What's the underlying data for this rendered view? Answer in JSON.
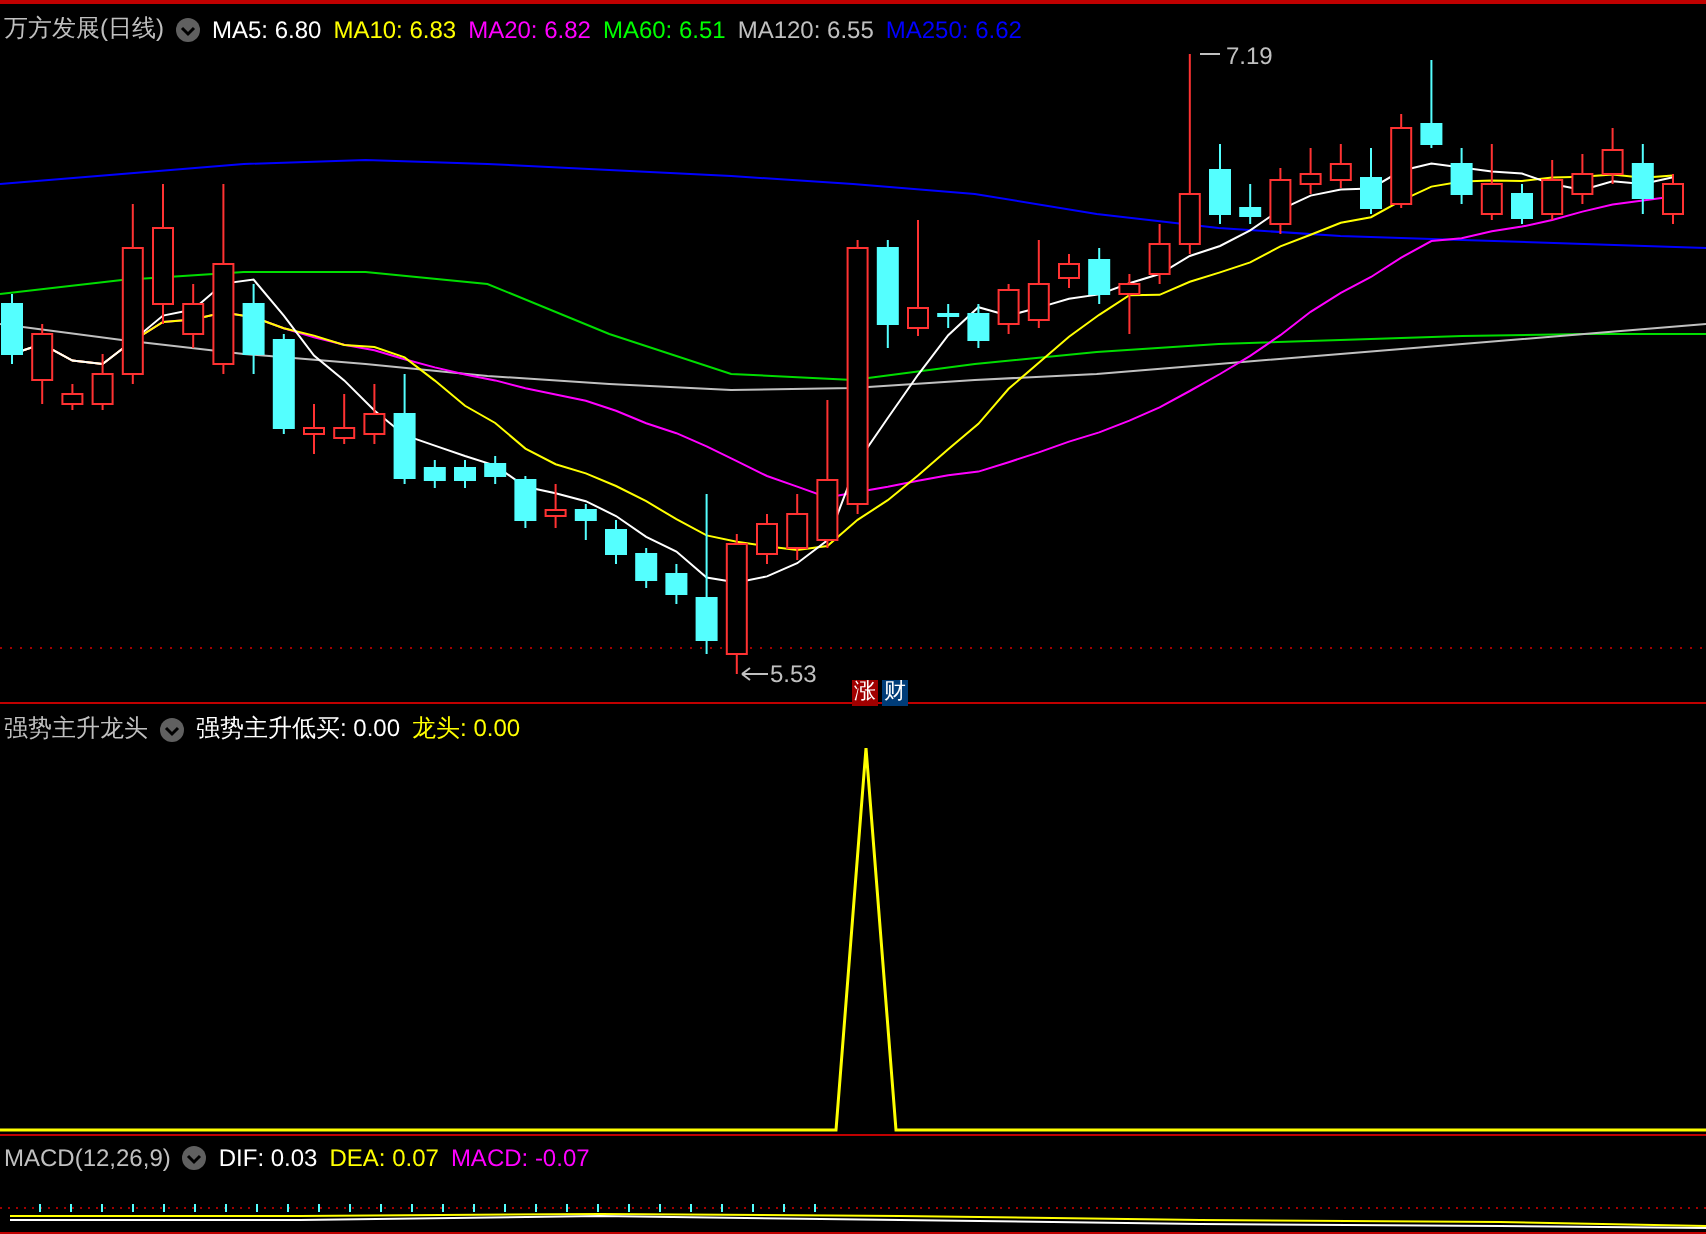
{
  "price_panel": {
    "title": "万方发展(日线)",
    "indicators": [
      {
        "label": "MA5: 6.80",
        "color": "#ffffff"
      },
      {
        "label": "MA10: 6.83",
        "color": "#ffff00"
      },
      {
        "label": "MA20: 6.82",
        "color": "#ff00ff"
      },
      {
        "label": "MA60: 6.51",
        "color": "#00ff00"
      },
      {
        "label": "MA120: 6.55",
        "color": "#c0c0c0"
      },
      {
        "label": "MA250: 6.62",
        "color": "#0000ff"
      }
    ],
    "high_label": "7.19",
    "low_label": "5.53",
    "badges": [
      {
        "text": "涨",
        "color": "#a00000"
      },
      {
        "text": "财",
        "color": "#003c78"
      }
    ]
  },
  "signal_panel": {
    "title": "强势主升龙头",
    "indicators": [
      {
        "label": "强势主升低买: 0.00",
        "color": "#ffffff"
      },
      {
        "label": "龙头: 0.00",
        "color": "#ffff00"
      }
    ]
  },
  "macd_panel": {
    "title": "MACD(12,26,9)",
    "indicators": [
      {
        "label": "DIF: 0.03",
        "color": "#ffffff"
      },
      {
        "label": "DEA: 0.07",
        "color": "#ffff00"
      },
      {
        "label": "MACD: -0.07",
        "color": "#ff00ff"
      }
    ]
  }
}
